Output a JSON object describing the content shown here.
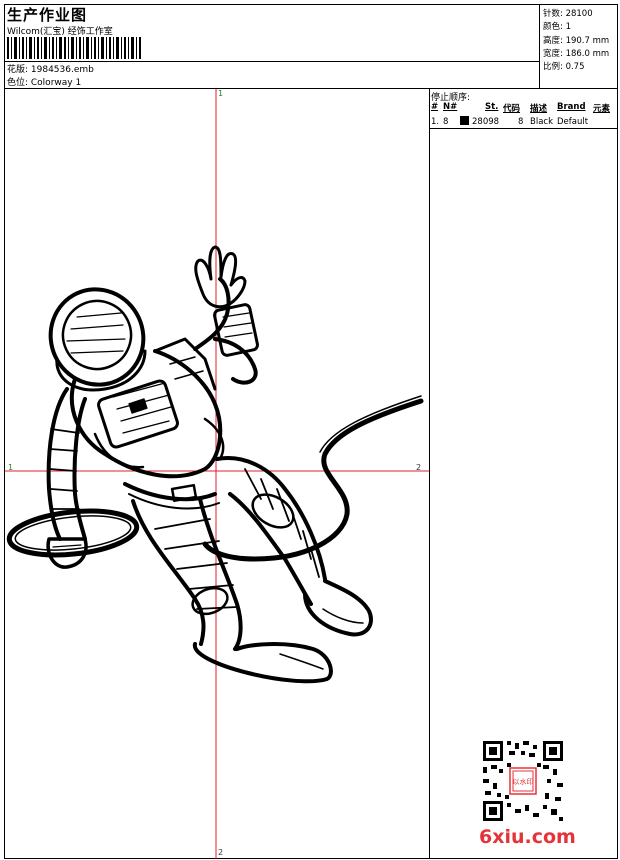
{
  "header": {
    "title": "生产作业图",
    "company": "Wilcom(汇宝) 经饰工作室",
    "design_label": "花版: 1984536.emb",
    "colorway_label": "色位: Colorway 1"
  },
  "stats": {
    "stitches": "针数: 28100",
    "colors": "颜色: 1",
    "height": "高度: 190.7 mm",
    "width": "宽度: 186.0 mm",
    "scale": "比例: 0.75"
  },
  "stop_sequence": {
    "title": "停止顺序:",
    "headers": [
      "#",
      "N#",
      "St.",
      "代码",
      "描述",
      "Brand",
      "元素"
    ],
    "rows": [
      {
        "index": "1.",
        "needle": "8",
        "swatch_color": "#000000",
        "stitches": "28098",
        "code": "8",
        "description": "Black",
        "brand": "Default",
        "element": ""
      }
    ]
  },
  "crosshair": {
    "top_label": "1",
    "bottom_label": "2",
    "left_label": "1",
    "right_label": "2"
  },
  "watermark": {
    "text": "6xiu.com",
    "qr_stamp_text": "以水印"
  },
  "colors": {
    "crosshair": "#e0202a",
    "watermark": "#e5333a"
  }
}
